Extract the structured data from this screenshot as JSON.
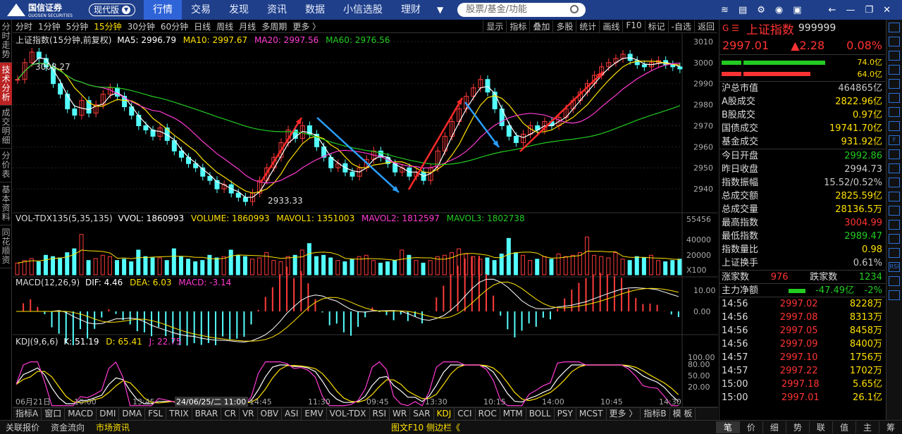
{
  "app": {
    "logo_name": "国信证券",
    "logo_sub": "GUOSEN SECURITIES",
    "mode": "现代版"
  },
  "nav": {
    "items": [
      "行情",
      "交易",
      "发现",
      "资讯",
      "数据",
      "小信选股",
      "理财"
    ],
    "active": "行情",
    "more": "▼"
  },
  "search": {
    "placeholder": "股票/基金/功能"
  },
  "top_icons": [
    "layers-icon",
    "f10-icon",
    "gear-icon",
    "avatar-icon",
    "message-icon"
  ],
  "window_controls": [
    "back-icon",
    "minimize-icon",
    "restore-icon",
    "close-icon"
  ],
  "left_tabs": [
    {
      "label": "分时走势",
      "active": false
    },
    {
      "label": "技术分析",
      "active": true
    },
    {
      "label": "成交明细",
      "active": false
    },
    {
      "label": "分价表",
      "active": false
    },
    {
      "label": "基本资料",
      "active": false
    },
    {
      "label": "同花顺资",
      "active": false
    }
  ],
  "periods": {
    "items": [
      "分时",
      "1分钟",
      "5分钟",
      "15分钟",
      "30分钟",
      "60分钟",
      "日线",
      "周线",
      "月线",
      "多周期",
      "更多 〉"
    ],
    "active": "15分钟"
  },
  "toolbar": {
    "items": [
      "显示",
      "指标",
      "叠加",
      "多股",
      "统计",
      "画线",
      "F10",
      "标记",
      "-自选",
      "返回"
    ]
  },
  "main_legend": {
    "title": "上证指数(15分钟,前复权)",
    "ma5": "MA5: 2996.79",
    "ma10": "MA10: 2997.67",
    "ma20": "MA20: 2997.56",
    "ma60": "MA60: 2976.56"
  },
  "vol_legend": {
    "title": "VOL-TDX135(5,35,135)",
    "vvol": "VVOL: 1860993",
    "volume": "VOLUME: 1860993",
    "mavol1": "MAVOL1: 1351003",
    "mavol2": "MAVOL2: 1812597",
    "mavol3": "MAVOL3: 1802738"
  },
  "macd_legend": {
    "title": "MACD(12,26,9)",
    "dif": "DIF: 4.46",
    "dea": "DEA: 6.03",
    "macd": "MACD: -3.14"
  },
  "kdj_legend": {
    "title": "KDJ(9,6,6)",
    "k": "K: 51.19",
    "d": "D: 65.41",
    "j": "J: 22.75"
  },
  "annotations": {
    "high": "3008.27",
    "low": "2933.33",
    "cursor_time": "24/06/25/二 11:00",
    "vol_top": "55456",
    "vol_unit": "X100"
  },
  "colors": {
    "up": "#ff3b3b",
    "down": "#54ffff",
    "ma5": "#ffffff",
    "ma10": "#ffe000",
    "ma20": "#ff3bd4",
    "ma60": "#22cc22",
    "arrow_up": "#ff2a2a",
    "arrow_down": "#2a9fff",
    "accent_blue": "#1f3f8a"
  },
  "chart_data": [
    {
      "type": "candlestick",
      "title": "上证指数(15分钟,前复权)",
      "x_ticks": [
        "06月21日",
        "10:00",
        "13:45",
        "11:30",
        "14:45",
        "11:30",
        "09:45",
        "13:30",
        "10:15",
        "14:00",
        "10:45",
        "14:30"
      ],
      "ylim": [
        2933,
        3010
      ],
      "y_ticks": [
        3010,
        3000,
        2990,
        2980,
        2970,
        2960,
        2950,
        2940
      ],
      "close": [
        2992,
        3000,
        3005,
        3002,
        2998,
        2990,
        2985,
        2978,
        2975,
        2982,
        2976,
        2980,
        2985,
        2988,
        2984,
        2979,
        2975,
        2970,
        2968,
        2965,
        2969,
        2963,
        2958,
        2955,
        2952,
        2950,
        2946,
        2944,
        2940,
        2942,
        2938,
        2936,
        2934,
        2938,
        2944,
        2950,
        2955,
        2962,
        2968,
        2964,
        2970,
        2966,
        2960,
        2955,
        2950,
        2952,
        2948,
        2946,
        2950,
        2954,
        2958,
        2955,
        2952,
        2948,
        2950,
        2946,
        2948,
        2944,
        2950,
        2958,
        2965,
        2972,
        2978,
        2984,
        2988,
        2992,
        2986,
        2978,
        2970,
        2965,
        2962,
        2966,
        2970,
        2968,
        2972,
        2970,
        2974,
        2978,
        2982,
        2986,
        2990,
        2994,
        2998,
        3000,
        3002,
        3004,
        3001,
        2999,
        2998,
        3000,
        3001,
        2999,
        2998,
        2997
      ],
      "series": [
        {
          "name": "MA5",
          "last": 2996.79
        },
        {
          "name": "MA10",
          "last": 2997.67
        },
        {
          "name": "MA20",
          "last": 2997.56
        },
        {
          "name": "MA60",
          "last": 2976.56
        }
      ]
    },
    {
      "type": "bar",
      "title": "VOL-TDX135(5,35,135)",
      "y_ticks": [
        55456,
        40000,
        20000
      ],
      "values": [
        18,
        22,
        25,
        20,
        30,
        28,
        26,
        34,
        40,
        62,
        22,
        25,
        30,
        28,
        22,
        24,
        20,
        38,
        28,
        26,
        26,
        22,
        40,
        28,
        24,
        20,
        22,
        30,
        26,
        28,
        38,
        30,
        28,
        24,
        26,
        34,
        22,
        20,
        28,
        30,
        38,
        48,
        28,
        30,
        26,
        22,
        20,
        24,
        28,
        30,
        22,
        18,
        20,
        22,
        38,
        30,
        22,
        18,
        22,
        28,
        30,
        34,
        40,
        32,
        28,
        24,
        26,
        22,
        32,
        56,
        34,
        30,
        22,
        24,
        28,
        24,
        32,
        28,
        30,
        34,
        58,
        30,
        28,
        26,
        34,
        24,
        22,
        28,
        26,
        30,
        22,
        20,
        22,
        24
      ]
    },
    {
      "type": "line",
      "title": "MACD(12,26,9)",
      "y_ticks": [
        10.0,
        0.0
      ],
      "series": [
        {
          "name": "DIF",
          "last": 4.46
        },
        {
          "name": "DEA",
          "last": 6.03
        },
        {
          "name": "MACD",
          "last": -3.14
        }
      ]
    },
    {
      "type": "line",
      "title": "KDJ(9,6,6)",
      "y_ticks": [
        100.0,
        80.0,
        50.0,
        20.0
      ],
      "series": [
        {
          "name": "K",
          "last": 51.19
        },
        {
          "name": "D",
          "last": 65.41
        },
        {
          "name": "J",
          "last": 22.75
        }
      ]
    }
  ],
  "bottom_tabs": {
    "items": [
      "指标A",
      "窗口",
      "MACD",
      "DMI",
      "DMA",
      "FSL",
      "TRIX",
      "BRAR",
      "CR",
      "VR",
      "OBV",
      "ASI",
      "EMV",
      "VOL-TDX",
      "RSI",
      "WR",
      "SAR",
      "KDJ",
      "CCI",
      "ROC",
      "MTM",
      "BOLL",
      "PSY",
      "MCST",
      "更多 〉",
      "指标B",
      "模 板"
    ],
    "active": "KDJ"
  },
  "status_bar": {
    "items": [
      "关联报价",
      "资金流向",
      "市场资讯"
    ],
    "highlight": "市场资讯",
    "right_label": "图文F10 侧边栏《",
    "right_tabs": [
      "笔",
      "价",
      "细",
      "势",
      "联",
      "值",
      "主",
      "筹"
    ],
    "right_active": "笔"
  },
  "sidebar": {
    "code_prefix": "G ☰",
    "name": "上证指数",
    "code": "999999",
    "price": "2997.01",
    "change": "▲2.28",
    "change_pct": "0.08%",
    "bar_up": "74.0亿",
    "bar_down": "64.0亿",
    "stats": [
      {
        "label": "沪总市值",
        "value": "464865亿",
        "color": "white"
      },
      {
        "label": "A股成交",
        "value": "2822.96亿",
        "color": "yellow"
      },
      {
        "label": "B股成交",
        "value": "0.97亿",
        "color": "yellow"
      },
      {
        "label": "国债成交",
        "value": "19741.70亿",
        "color": "yellow"
      },
      {
        "label": "基金成交",
        "value": "931.92亿",
        "color": "yellow"
      }
    ],
    "stats2": [
      {
        "label": "今日开盘",
        "value": "2992.86",
        "color": "green"
      },
      {
        "label": "昨日收盘",
        "value": "2994.73",
        "color": "white"
      },
      {
        "label": "指数振幅",
        "value": "15.52/0.52%",
        "color": "white"
      },
      {
        "label": "总成交额",
        "value": "2825.59亿",
        "color": "yellow"
      },
      {
        "label": "总成交量",
        "value": "28136.5万",
        "color": "yellow"
      },
      {
        "label": "最高指数",
        "value": "3004.99",
        "color": "red"
      },
      {
        "label": "最低指数",
        "value": "2989.47",
        "color": "green"
      },
      {
        "label": "指数量比",
        "value": "0.98",
        "color": "yellow"
      },
      {
        "label": "上证换手",
        "value": "0.61%",
        "color": "white"
      }
    ],
    "breadth": {
      "up_label": "涨家数",
      "up": "976",
      "down_label": "跌家数",
      "down": "1234"
    },
    "main_flow": {
      "label": "主力净额",
      "value": "-47.49亿",
      "pct": "-2%"
    },
    "ticks": [
      {
        "time": "14:56",
        "price": "2997.02",
        "vol": "8228万"
      },
      {
        "time": "14:56",
        "price": "2997.08",
        "vol": "8313万"
      },
      {
        "time": "14:56",
        "price": "2997.05",
        "vol": "8458万"
      },
      {
        "time": "14:56",
        "price": "2997.09",
        "vol": "8400万"
      },
      {
        "time": "14:57",
        "price": "2997.10",
        "vol": "1756万"
      },
      {
        "time": "14:57",
        "price": "2997.22",
        "vol": "1702万"
      },
      {
        "time": "15:00",
        "price": "2997.18",
        "vol": "5.65亿"
      },
      {
        "time": "15:00",
        "price": "2997.01",
        "vol": "26.1亿"
      }
    ]
  },
  "right_strip_icons": [
    "up-arrow-icon",
    "down-arrow-icon",
    "grid-icon",
    "list-icon",
    "zoom-icon",
    "chart-icon",
    "line-chart-icon",
    "compare-icon",
    "f10-icon",
    "people-icon",
    "rank-icon",
    "screen-icon",
    "doc-icon",
    "pie-icon",
    "table-icon",
    "trend-icon",
    "wave-icon",
    "rsi-icon",
    "pen-icon",
    "more-icon"
  ],
  "right_strip_labels": {
    "rsi": "RSI",
    "f": "F"
  }
}
